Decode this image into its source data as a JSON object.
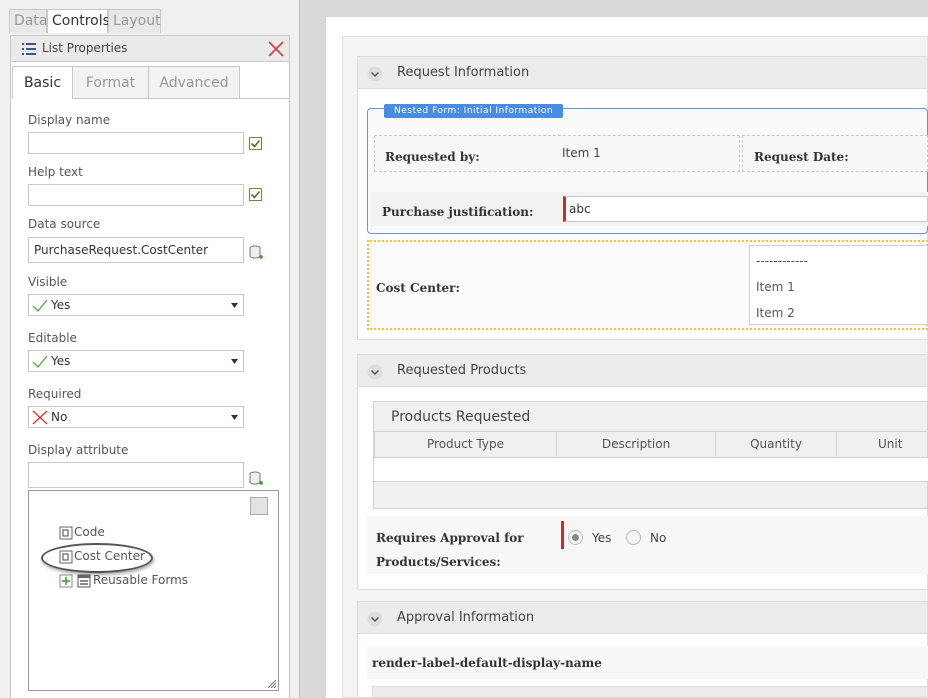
{
  "left_panel": {
    "top_tabs": [
      "Data",
      "Controls",
      "Layout"
    ],
    "header_title": "List Properties",
    "sub_tabs": [
      "Basic",
      "Format",
      "Advanced"
    ],
    "fields": {
      "display_name": {
        "label": "Display name",
        "value": ""
      },
      "help_text": {
        "label": "Help text",
        "value": ""
      },
      "data_source": {
        "label": "Data source",
        "value": "PurchaseRequest.CostCenter"
      },
      "visible": {
        "label": "Visible",
        "value": "Yes"
      },
      "editable": {
        "label": "Editable",
        "value": "Yes"
      },
      "required": {
        "label": "Required",
        "value": "No"
      },
      "display_attribute": {
        "label": "Display attribute",
        "value": ""
      }
    },
    "tree": [
      "Code",
      "Cost Center",
      "Reusable Forms"
    ]
  },
  "form": {
    "request_info": {
      "title": "Request Information",
      "nested_tag": "Nested Form: Initial Information",
      "requested_by_label": "Requested by:",
      "requested_by_value": "Item 1",
      "request_date_label": "Request Date:",
      "justification_label": "Purchase justification:",
      "justification_value": "abc",
      "cost_center_label": "Cost Center:",
      "cost_center_options": [
        "------------",
        "Item 1",
        "Item 2"
      ]
    },
    "requested_products": {
      "title": "Requested Products",
      "table_title": "Products Requested",
      "columns": [
        "Product Type",
        "Description",
        "Quantity",
        "Unit Price"
      ],
      "approval_label_line1": "Requires Approval for",
      "approval_label_line2": "Products/Services:",
      "approval_options": [
        "Yes",
        "No"
      ],
      "approval_selected": "Yes"
    },
    "approval_info": {
      "title": "Approval Information",
      "placeholder_label": "render-label-default-display-name"
    }
  },
  "colors": {
    "required": "#d8242b",
    "nested_border": "#4a8de0",
    "highlight_dotted": "#f0c040"
  }
}
